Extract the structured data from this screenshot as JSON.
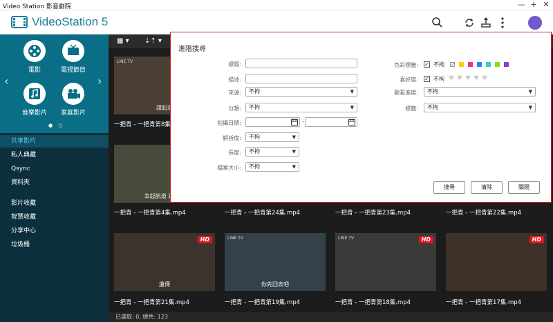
{
  "window": {
    "title": "Video Station 影音劇院",
    "min": "—",
    "max": "+",
    "close": "✕"
  },
  "header": {
    "brand": "VideoStation 5"
  },
  "sidebar": {
    "categories": [
      {
        "label": "電影",
        "icon": "film-reel-icon"
      },
      {
        "label": "電視節目",
        "icon": "tv-icon"
      },
      {
        "label": "音樂影片",
        "icon": "music-note-icon"
      },
      {
        "label": "家庭影片",
        "icon": "camcorder-icon"
      }
    ],
    "nav": [
      "共享影片",
      "私人典藏",
      "Qsync",
      "資料夾",
      "影片收藏",
      "智慧收藏",
      "分享中心",
      "垃圾桶"
    ],
    "active_index": 0
  },
  "toolbar": {
    "view_label": "▦ ▾",
    "sort_label": "⇣⇡ ▾"
  },
  "grid": {
    "row1": [
      {
        "caption": "一把青 - 一把青第8集.mp4",
        "subtitle": "請起來",
        "tv": "LINE TV",
        "hd": ""
      }
    ],
    "row2": [
      {
        "caption": "一把青 - 一把青第4集.mp4",
        "subtitle": "幸起航道 是什麼",
        "tv": "",
        "hd": ""
      },
      {
        "caption": "一把青 - 一把青第24集.mp4",
        "subtitle": "",
        "tv": "",
        "hd": ""
      },
      {
        "caption": "一把青 - 一把青第23集.mp4",
        "subtitle": "",
        "tv": "",
        "hd": ""
      },
      {
        "caption": "一把青 - 一把青第22集.mp4",
        "subtitle": "",
        "tv": "",
        "hd": ""
      }
    ],
    "row3": [
      {
        "caption": "一把青 - 一把青第21集.mp4",
        "subtitle": "遺傳",
        "tv": "",
        "hd": "HD"
      },
      {
        "caption": "一把青 - 一把青第19集.mp4",
        "subtitle": "你先回去吧",
        "tv": "LINE TV",
        "hd": ""
      },
      {
        "caption": "一把青 - 一把青第18集.mp4",
        "subtitle": "",
        "tv": "LINE TV",
        "hd": "HD"
      },
      {
        "caption": "一把青 - 一把青第17集.mp4",
        "subtitle": "",
        "tv": "",
        "hd": "HD"
      }
    ]
  },
  "status": "已選取: 0, 總共: 123",
  "dialog": {
    "title": "進階搜尋",
    "left_fields": [
      {
        "label": "標題:",
        "type": "text",
        "value": ""
      },
      {
        "label": "描述:",
        "type": "text",
        "value": ""
      },
      {
        "label": "來源:",
        "type": "select",
        "value": "不拘"
      },
      {
        "label": "分類:",
        "type": "select",
        "value": "不拘"
      },
      {
        "label": "拍攝日期:",
        "type": "date",
        "value": ""
      },
      {
        "label": "解析度:",
        "type": "select",
        "value": "不拘"
      },
      {
        "label": "長度:",
        "type": "select",
        "value": "不拘"
      },
      {
        "label": "檔案大小:",
        "type": "select",
        "value": "不拘"
      }
    ],
    "date_separator": "-",
    "right_fields": {
      "color_label": "色彩標籤:",
      "color_any": "不拘",
      "colors": [
        "#ffffff",
        "#f5d400",
        "#ff2d8e",
        "#1e88ff",
        "#36c8d8",
        "#9ad41e",
        "#8e3ad6"
      ],
      "rating_label": "喜好度:",
      "rating_any": "不拘",
      "progress_label": "觀看進度:",
      "progress_value": "不拘",
      "tag_label": "標籤:",
      "tag_value": "不拘"
    },
    "buttons": {
      "search": "搜尋",
      "clear": "清除",
      "close": "關閉"
    }
  }
}
